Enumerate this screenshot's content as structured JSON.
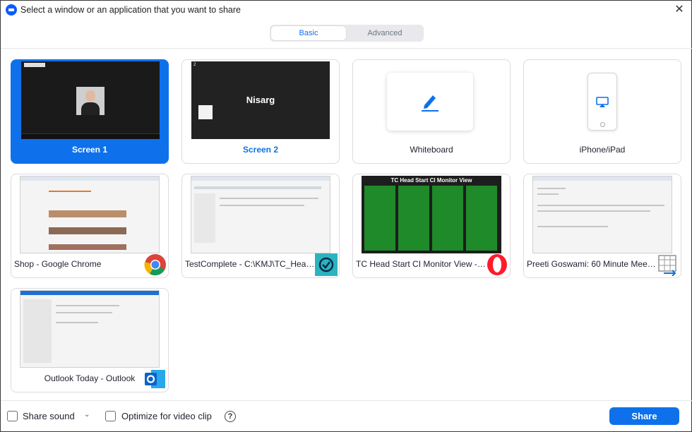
{
  "window": {
    "title": "Select a window or an application that you want to share",
    "close_glyph": "✕"
  },
  "tabs": [
    {
      "label": "Basic",
      "active": true
    },
    {
      "label": "Advanced",
      "active": false
    }
  ],
  "cards": [
    {
      "label": "Screen 1",
      "selected": true,
      "thumb_text": ""
    },
    {
      "label": "Screen 2",
      "selected": false,
      "thumb_text": "Nisarg",
      "thumb_num": "2"
    },
    {
      "label": "Whiteboard",
      "selected": false,
      "icon": "pencil-icon"
    },
    {
      "label": "iPhone/iPad",
      "selected": false,
      "icon": "airplay-icon"
    },
    {
      "label": "Shop - Google Chrome",
      "selected": false,
      "icon": "chrome-icon"
    },
    {
      "label": "TestComplete - C:\\KMJ\\TC_Head...",
      "selected": false,
      "icon": "testcomplete-icon"
    },
    {
      "label": "TC Head Start CI Monitor View - ...",
      "selected": false,
      "icon": "opera-icon",
      "thumb_title": "TC Head Start CI Monitor View"
    },
    {
      "label": "Preeti Goswami: 60 Minute Meeti...",
      "selected": false,
      "icon": "calendar-icon"
    },
    {
      "label": "Outlook Today - Outlook",
      "selected": false,
      "icon": "outlook-icon"
    }
  ],
  "footer": {
    "share_sound": "Share sound",
    "optimize": "Optimize for video clip",
    "help_glyph": "?",
    "chevron_glyph": "⌄",
    "share_button": "Share"
  },
  "colors": {
    "accent": "#0e71eb",
    "selected_card": "#0e71eb"
  }
}
